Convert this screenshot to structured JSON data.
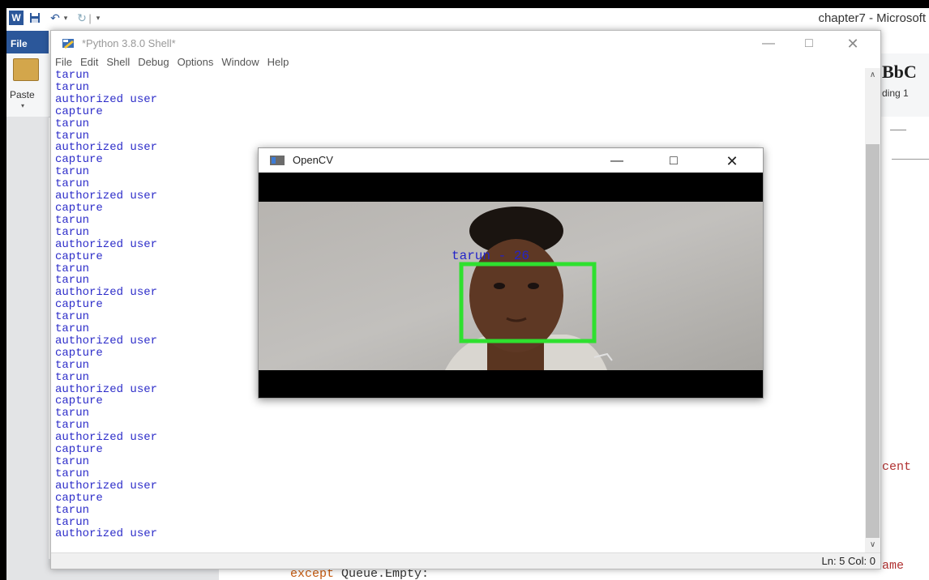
{
  "word": {
    "window_title": "chapter7 - Microsoft",
    "logo": "W",
    "file_tab": "File",
    "paste_label": "Paste",
    "style_sample": "BbC",
    "style_name": "ding 1",
    "right_text_1": "cent",
    "right_text_2": "ame",
    "bottom_code_keyword": "except",
    "bottom_code_rest": " Queue.Empty:"
  },
  "idle": {
    "title": "*Python 3.8.0 Shell*",
    "menu": [
      "File",
      "Edit",
      "Shell",
      "Debug",
      "Options",
      "Window",
      "Help"
    ],
    "output_lines": [
      "tarun",
      "tarun",
      "authorized user",
      "capture",
      "tarun",
      "tarun",
      "authorized user",
      "capture",
      "tarun",
      "tarun",
      "authorized user",
      "capture",
      "tarun",
      "tarun",
      "authorized user",
      "capture",
      "tarun",
      "tarun",
      "authorized user",
      "capture",
      "tarun",
      "tarun",
      "authorized user",
      "capture",
      "tarun",
      "tarun",
      "authorized user",
      "capture",
      "tarun",
      "tarun",
      "authorized user",
      "capture",
      "tarun",
      "tarun",
      "authorized user",
      "capture",
      "tarun",
      "tarun",
      "authorized user"
    ],
    "status": "Ln: 5  Col: 0"
  },
  "opencv": {
    "title": "OpenCV",
    "detection_label": "tarun - 26",
    "box_color": "#2fe02f",
    "label_color": "#2323c8"
  }
}
